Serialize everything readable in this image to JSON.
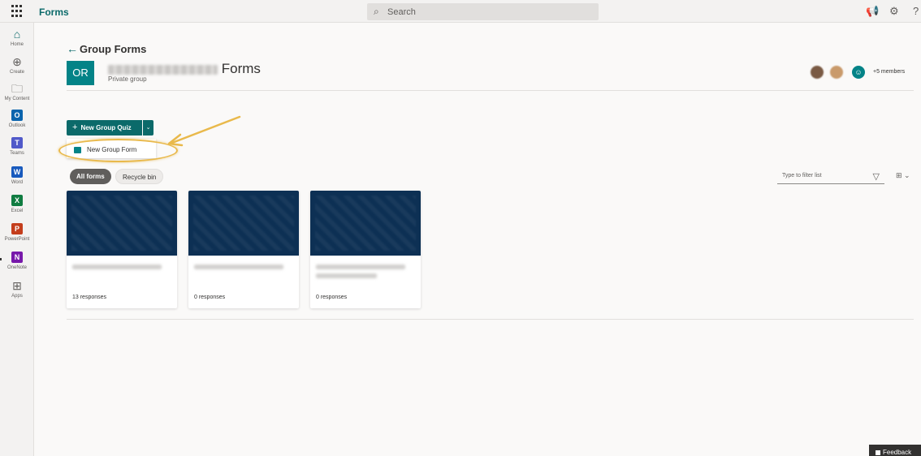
{
  "topbar": {
    "app_name": "Forms",
    "search_placeholder": "Search",
    "help_label": "?"
  },
  "leftrail": {
    "items": [
      {
        "label": "Home",
        "icon": "home-icon"
      },
      {
        "label": "Create",
        "icon": "plus-circle-icon"
      },
      {
        "label": "My Content",
        "icon": "folder-icon"
      },
      {
        "label": "Outlook",
        "icon": "outlook-icon",
        "glyph": "O",
        "color": "#0a64ad"
      },
      {
        "label": "Teams",
        "icon": "teams-icon",
        "glyph": "T",
        "color": "#5059c9"
      },
      {
        "label": "Word",
        "icon": "word-icon",
        "glyph": "W",
        "color": "#185abd"
      },
      {
        "label": "Excel",
        "icon": "excel-icon",
        "glyph": "X",
        "color": "#107c41"
      },
      {
        "label": "PowerPoint",
        "icon": "powerpoint-icon",
        "glyph": "P",
        "color": "#c43e1c"
      },
      {
        "label": "OneNote",
        "icon": "onenote-icon",
        "glyph": "N",
        "color": "#7719aa"
      },
      {
        "label": "Apps",
        "icon": "apps-grid-icon"
      }
    ]
  },
  "header": {
    "back_title": "Group Forms",
    "group_initials": "OR",
    "group_name_suffix": "Forms",
    "group_subtitle": "Private group",
    "members_text": "+5 members"
  },
  "actions": {
    "new_quiz_label": "New Group Quiz",
    "dropdown_item_label": "New Group Form"
  },
  "filters": {
    "all_forms": "All forms",
    "recycle_bin": "Recycle bin",
    "filter_placeholder": "Type to filter list"
  },
  "cards": [
    {
      "responses": "13 responses"
    },
    {
      "responses": "0 responses"
    },
    {
      "responses": "0 responses"
    }
  ],
  "feedback": {
    "label": "Feedback"
  },
  "colors": {
    "accent": "#0b6a6a",
    "group_tile": "#038387",
    "card_thumb": "#0d3054",
    "highlight": "#e9b94b"
  }
}
